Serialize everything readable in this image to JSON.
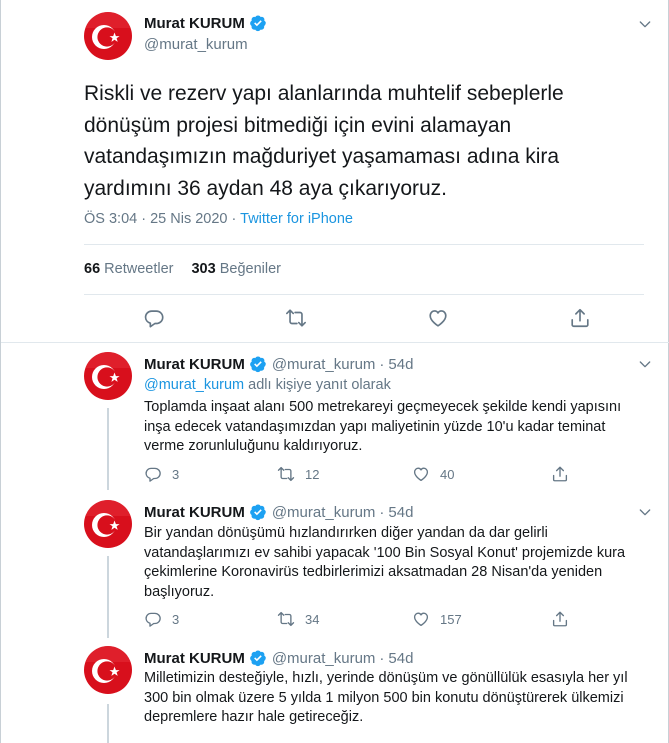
{
  "main_tweet": {
    "display_name": "Murat KURUM",
    "handle": "@murat_kurum",
    "text": "Riskli ve rezerv yapı alanlarında muhtelif sebeplerle dönüşüm projesi bitmediği için evini alamayan vatandaşımızın mağduriyet yaşamaması adına kira yardımını 36 aydan 48 aya çıkarıyoruz.",
    "time": "ÖS 3:04",
    "date": "25 Nis 2020",
    "separator": "·",
    "source": "Twitter for iPhone",
    "retweets_count": "66",
    "retweets_label": "Retweetler",
    "likes_count": "303",
    "likes_label": "Beğeniler"
  },
  "replies": [
    {
      "display_name": "Murat KURUM",
      "handle": "@murat_kurum",
      "dot": "·",
      "age": "54d",
      "reply_to_mention": "@murat_kurum",
      "reply_to_suffix": "adlı kişiye yanıt olarak",
      "text": "Toplamda inşaat alanı 500 metrekareyi geçmeyecek şekilde kendi yapısını inşa edecek vatandaşımızdan yapı maliyetinin yüzde 10'u kadar teminat verme zorunluluğunu kaldırıyoruz.",
      "replies_count": "3",
      "retweets_count": "12",
      "likes_count": "40"
    },
    {
      "display_name": "Murat KURUM",
      "handle": "@murat_kurum",
      "dot": "·",
      "age": "54d",
      "text": "Bir yandan dönüşümü hızlandırırken diğer yandan da dar gelirli vatandaşlarımızı ev sahibi yapacak '100 Bin Sosyal Konut' projemizde kura çekimlerine Koronavirüs tedbirlerimizi aksatmadan 28 Nisan'da yeniden başlıyoruz.",
      "replies_count": "3",
      "retweets_count": "34",
      "likes_count": "157"
    },
    {
      "display_name": "Murat KURUM",
      "handle": "@murat_kurum",
      "dot": "·",
      "age": "54d",
      "text": "Milletimizin desteğiyle, hızlı, yerinde dönüşüm ve gönüllülük esasıyla her yıl 300 bin olmak üzere 5 yılda 1 milyon 500 bin konutu dönüştürerek ülkemizi depremlere hazır hale getireceğiz."
    }
  ],
  "icons": {
    "verified": "verified-badge-icon",
    "caret": "chevron-down-icon",
    "reply": "reply-icon",
    "retweet": "retweet-icon",
    "like": "heart-icon",
    "share": "share-icon"
  },
  "colors": {
    "accent": "#1da1f2",
    "link": "#1b95e0",
    "secondary_text": "#657786",
    "flag_red": "#e30a17"
  }
}
